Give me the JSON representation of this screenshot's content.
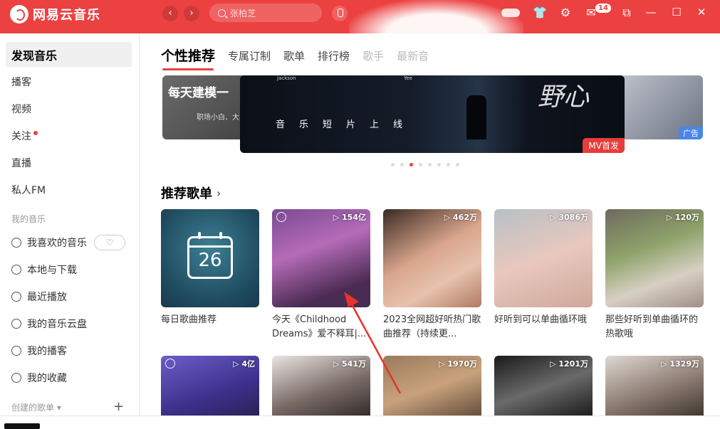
{
  "app": {
    "title": "网易云音乐",
    "brand_color": "#ec4141"
  },
  "header": {
    "search_placeholder": "张柏芝",
    "back_icon": "chevron-left-icon",
    "forward_icon": "chevron-right-icon",
    "message_badge": "14",
    "icons": [
      "skin-icon",
      "settings-icon",
      "mail-icon",
      "mini-mode-icon",
      "minimize-icon",
      "maximize-icon",
      "close-icon"
    ]
  },
  "sidebar": {
    "items": [
      {
        "label": "发现音乐"
      },
      {
        "label": "播客"
      },
      {
        "label": "视频"
      },
      {
        "label": "关注"
      },
      {
        "label": "直播"
      },
      {
        "label": "私人FM"
      }
    ],
    "my_music_title": "我的音乐",
    "my_music": [
      {
        "label": "我喜欢的音乐",
        "icon": "heart-icon"
      },
      {
        "label": "本地与下载",
        "icon": "download-icon"
      },
      {
        "label": "最近播放",
        "icon": "clock-icon"
      },
      {
        "label": "我的音乐云盘",
        "icon": "cloud-icon"
      },
      {
        "label": "我的播客",
        "icon": "podcast-icon"
      },
      {
        "label": "我的收藏",
        "icon": "collection-icon"
      }
    ],
    "created_title": "创建的歌单"
  },
  "tabs": [
    {
      "label": "个性推荐"
    },
    {
      "label": "专属订制"
    },
    {
      "label": "歌单"
    },
    {
      "label": "排行榜"
    },
    {
      "label": "歌手"
    },
    {
      "label": "最新音"
    }
  ],
  "banner": {
    "left_text": "每天建模一",
    "left_sub": "职场小白、大",
    "main_text": "音乐短片上线",
    "main_tag_left": "Jackson",
    "main_tag_right": "Yee",
    "main_calligraphy": "野心",
    "main_tag": "MV首发",
    "right_tag": "广告",
    "dots_total": 8,
    "dots_active_index": 2
  },
  "section": {
    "title": "推荐歌单"
  },
  "playlists": [
    {
      "title": "每日歌曲推荐",
      "count": "",
      "calendar_day": "26"
    },
    {
      "title": "今天《Childhood Dreams》爱不释耳|...",
      "count": "154亿"
    },
    {
      "title": "2023全网超好听热门歌曲推荐（持续更...",
      "count": "462万"
    },
    {
      "title": "好听到可以单曲循环哦",
      "count": "3086万"
    },
    {
      "title": "那些好听到单曲循环的热歌哦",
      "count": "120万"
    },
    {
      "title": "",
      "count": "4亿"
    },
    {
      "title": "",
      "count": "541万"
    },
    {
      "title": "",
      "count": "1970万"
    },
    {
      "title": "",
      "count": "1201万"
    },
    {
      "title": "",
      "count": "1329万"
    }
  ]
}
